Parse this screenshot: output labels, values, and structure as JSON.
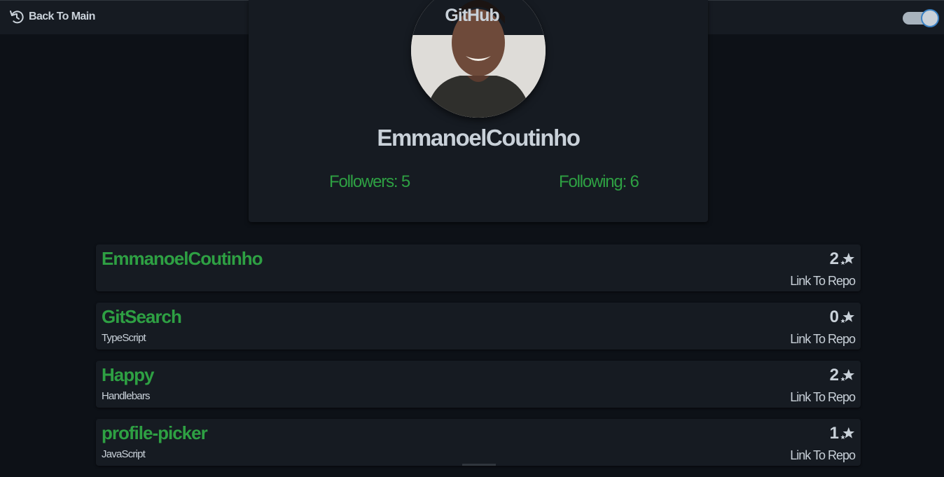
{
  "header": {
    "back_label": "Back To Main",
    "back_icon": "undo-icon",
    "brand": "GitHub",
    "theme_toggle_on": true
  },
  "profile": {
    "username": "EmmanoelCoutinho",
    "followers_label": "Followers: 5",
    "following_label": "Following: 6",
    "followers": 5,
    "following": 6
  },
  "repos": [
    {
      "name": "EmmanoelCoutinho",
      "language": "",
      "stars": "2",
      "link_label": "Link To Repo"
    },
    {
      "name": "GitSearch",
      "language": "TypeScript",
      "stars": "0",
      "link_label": "Link To Repo"
    },
    {
      "name": "Happy",
      "language": "Handlebars",
      "stars": "2",
      "link_label": "Link To Repo"
    },
    {
      "name": "profile-picker",
      "language": "JavaScript",
      "stars": "1",
      "link_label": "Link To Repo"
    }
  ],
  "colors": {
    "background": "#0d1117",
    "surface": "#161b22",
    "accent_green": "#2ea043",
    "text": "#c9d1d9",
    "toggle_border": "#3b82c4"
  }
}
